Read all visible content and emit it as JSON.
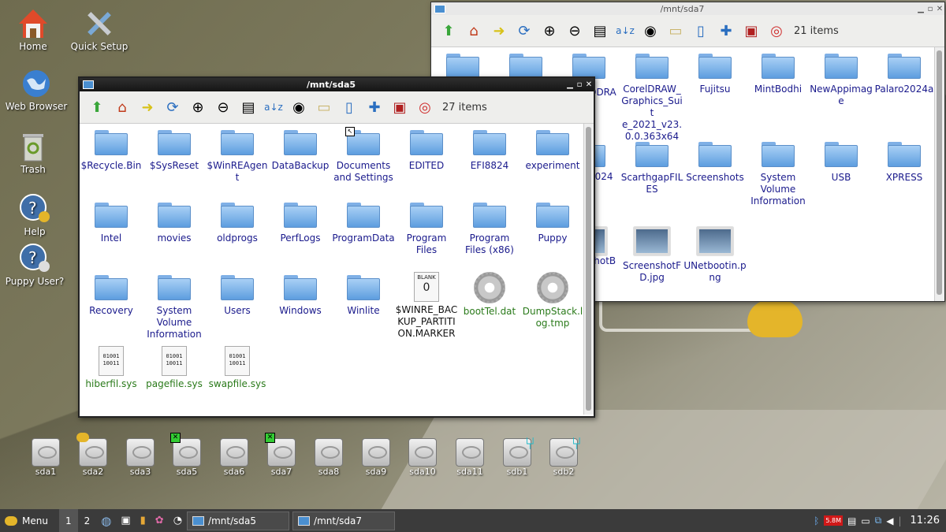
{
  "desktop": {
    "icons": [
      {
        "label": "Home",
        "icon": "home-icon"
      },
      {
        "label": "Quick Setup",
        "icon": "tools-icon"
      },
      {
        "label": "Web Browser",
        "icon": "globe-icon"
      },
      {
        "label": "Trash",
        "icon": "trash-icon"
      },
      {
        "label": "Help",
        "icon": "help-icon"
      },
      {
        "label": "Puppy User?",
        "icon": "puppy-user-icon"
      }
    ],
    "drives": [
      "sda1",
      "sda2",
      "sda3",
      "sda5",
      "sda6",
      "sda7",
      "sda8",
      "sda9",
      "sda10",
      "sda11",
      "sdb1",
      "sdb2"
    ]
  },
  "window_sda7": {
    "title": "/mnt/sda7",
    "count": "21 items",
    "items": [
      {
        "label": "CorelDRAW_ Graphics_Suit e_2021_v23. 0.0.363x64"
      },
      {
        "label": "Fujitsu"
      },
      {
        "label": "MintBodhi"
      },
      {
        "label": "NewAppimag e"
      },
      {
        "label": "Palaro2024a"
      },
      {
        "label": "ScarthgapFIL ES"
      },
      {
        "label": "Screenshots"
      },
      {
        "label": "System Volume Information"
      },
      {
        "label": "USB"
      },
      {
        "label": "XPRESS"
      },
      {
        "label": "ScreenshotF D.jpg"
      },
      {
        "label": "UNetbootin.p ng"
      }
    ],
    "partial": [
      "ODRA",
      "2024",
      "shotB"
    ]
  },
  "window_sda5": {
    "title": "/mnt/sda5",
    "count": "27 items",
    "items": [
      {
        "label": "$Recycle.Bin"
      },
      {
        "label": "$SysReset"
      },
      {
        "label": "$WinREAgent"
      },
      {
        "label": "DataBackup"
      },
      {
        "label": "Documents and Settings"
      },
      {
        "label": "EDITED"
      },
      {
        "label": "EFI8824"
      },
      {
        "label": "experiment"
      },
      {
        "label": "Intel"
      },
      {
        "label": "movies"
      },
      {
        "label": "oldprogs"
      },
      {
        "label": "PerfLogs"
      },
      {
        "label": "ProgramData"
      },
      {
        "label": "Program Files"
      },
      {
        "label": "Program Files (x86)"
      },
      {
        "label": "Puppy"
      },
      {
        "label": "Recovery"
      },
      {
        "label": "System Volume Information"
      },
      {
        "label": "Users"
      },
      {
        "label": "Windows"
      },
      {
        "label": "Winlite"
      },
      {
        "label": "$WINRE_BAC KUP_PARTITI ON.MARKER"
      },
      {
        "label": "bootTel.dat"
      },
      {
        "label": "DumpStack.l og.tmp"
      },
      {
        "label": "hiberfil.sys"
      },
      {
        "label": "pagefile.sys"
      },
      {
        "label": "swapfile.sys"
      }
    ],
    "blank_label": "BLANK",
    "blank_glyph": "0",
    "binary_glyph": "01001 10011"
  },
  "taskbar": {
    "menu_label": "Menu",
    "desktops": [
      "1",
      "2"
    ],
    "tasks": [
      "/mnt/sda5",
      "/mnt/sda7"
    ],
    "net_badge": "5.8M",
    "clock": "11:26"
  }
}
